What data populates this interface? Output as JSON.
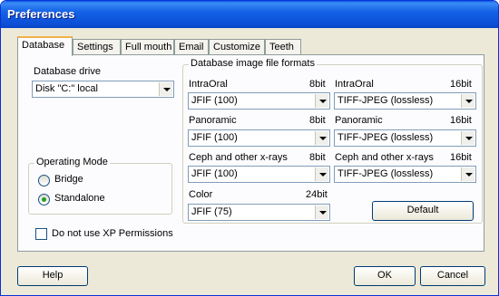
{
  "window": {
    "title": "Preferences"
  },
  "tabs": [
    {
      "label": "Database",
      "active": true
    },
    {
      "label": "Settings",
      "active": false
    },
    {
      "label": "Full mouth",
      "active": false
    },
    {
      "label": "Email",
      "active": false
    },
    {
      "label": "Customize",
      "active": false
    },
    {
      "label": "Teeth",
      "active": false
    }
  ],
  "database": {
    "drive_label": "Database drive",
    "drive_value": "Disk \"C:\" local"
  },
  "operating_mode": {
    "legend": "Operating Mode",
    "bridge_label": "Bridge",
    "standalone_label": "Standalone",
    "selected": "Standalone"
  },
  "xp_permissions": {
    "label": "Do not use XP Permissions",
    "checked": false
  },
  "formats": {
    "legend": "Database image file formats",
    "intraoral_8": {
      "label": "IntraOral",
      "bits": "8bit",
      "value": "JFIF (100)"
    },
    "intraoral_16": {
      "label": "IntraOral",
      "bits": "16bit",
      "value": "TIFF-JPEG (lossless)"
    },
    "panoramic_8": {
      "label": "Panoramic",
      "bits": "8bit",
      "value": "JFIF (100)"
    },
    "panoramic_16": {
      "label": "Panoramic",
      "bits": "16bit",
      "value": "TIFF-JPEG (lossless)"
    },
    "ceph_8": {
      "label": "Ceph and other x-rays",
      "bits": "8bit",
      "value": "JFIF (100)"
    },
    "ceph_16": {
      "label": "Ceph and other x-rays",
      "bits": "16bit",
      "value": "TIFF-JPEG (lossless)"
    },
    "color": {
      "label": "Color",
      "bits": "24bit",
      "value": "JFIF (75)"
    },
    "default_button": "Default"
  },
  "footer": {
    "help": "Help",
    "ok": "OK",
    "cancel": "Cancel"
  }
}
